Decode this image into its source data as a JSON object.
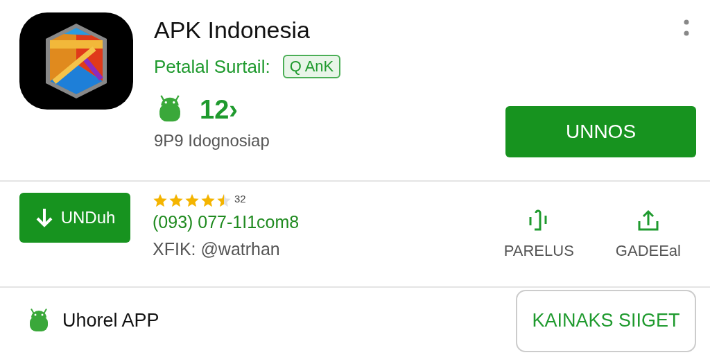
{
  "app": {
    "title": "APK Indonesia",
    "subtitle": "Petalal Surtail:",
    "badge": "Q AnK",
    "version": "12›",
    "meta": "9P9 Idognosiap",
    "primary_button": "UNNOS"
  },
  "download": {
    "button": "UNDuh",
    "stars": 4.5,
    "rating_count": "32",
    "phone": "(093) 077-1I1com8",
    "handle": "XFIK: @watrhan"
  },
  "actions": [
    {
      "kind": "vibrate",
      "label": "PARELUS"
    },
    {
      "kind": "share",
      "label": "GADEEal"
    }
  ],
  "footer": {
    "label": "Uhorel APP",
    "button": "KAINAKS SIIGET"
  }
}
